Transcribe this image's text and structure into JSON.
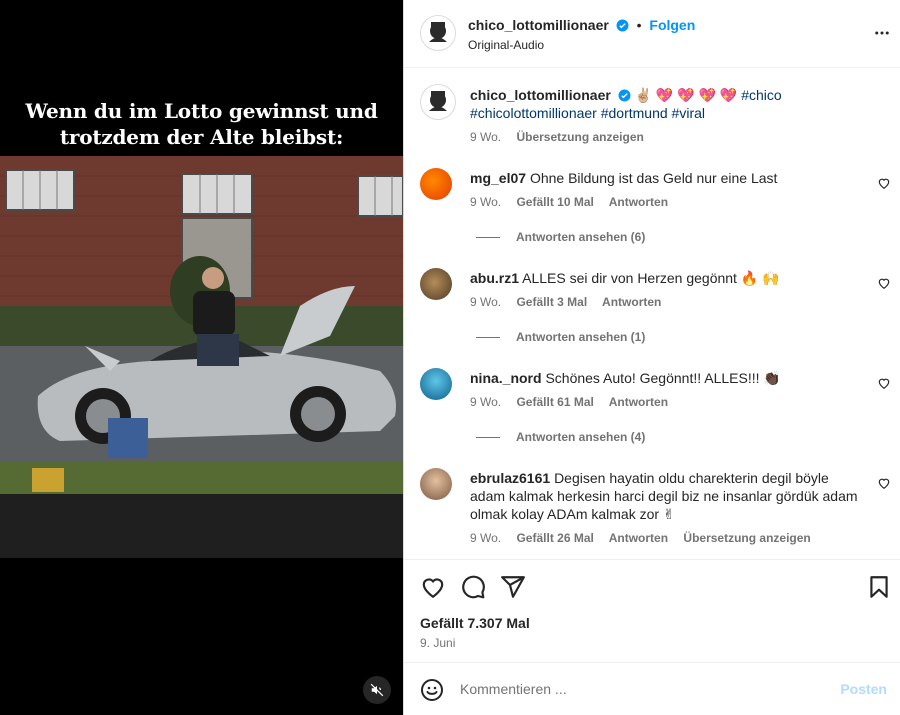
{
  "media": {
    "caption_line1": "Wenn du im Lotto gewinnst und",
    "caption_line2": "trotzdem der Alte bleibst:"
  },
  "header": {
    "username": "chico_lottomillionaer",
    "separator": "•",
    "follow_label": "Folgen",
    "audio": "Original-Audio",
    "more_icon": "more-horizontal-icon"
  },
  "post_caption": {
    "username": "chico_lottomillionaer",
    "emojis": "✌🏼 💖 💖 💖 💖",
    "hashtags_line1": "#chico",
    "hashtags_line2": "#chicolottomillionaer #dortmund #viral",
    "age": "9 Wo.",
    "translate": "Übersetzung anzeigen"
  },
  "comments": [
    {
      "username": "mg_el07",
      "text": "Ohne Bildung ist das Geld nur eine Last",
      "age": "9 Wo.",
      "likes": "Gefällt 10 Mal",
      "reply": "Antworten",
      "view_replies": "Antworten ansehen (6)",
      "avatar_color": "#ff6a00"
    },
    {
      "username": "abu.rz1",
      "text": "ALLES sei dir von Herzen gegönnt 🔥 🙌",
      "age": "9 Wo.",
      "likes": "Gefällt 3 Mal",
      "reply": "Antworten",
      "view_replies": "Antworten ansehen (1)",
      "avatar_color": "#7a5a38"
    },
    {
      "username": "nina._nord",
      "text": "Schönes Auto! Gegönnt!! ALLES!!! 👏🏿",
      "age": "9 Wo.",
      "likes": "Gefällt 61 Mal",
      "reply": "Antworten",
      "view_replies": "Antworten ansehen (4)",
      "avatar_color": "#1f86b8"
    },
    {
      "username": "ebrulaz6161",
      "line1": "Degisen hayatin oldu charekterin degil böyle",
      "line2": "adam kalmak herkesin harci degil biz ne insanlar gördük adam",
      "line3": "olmak kolay ADAm kalmak zor ✌",
      "age": "9 Wo.",
      "likes": "Gefällt 26 Mal",
      "reply": "Antworten",
      "translate": "Übersetzung anzeigen",
      "avatar_color": "#c49a78"
    }
  ],
  "actions": {
    "likes": "Gefällt 7.307 Mal",
    "date": "9. Juni",
    "icons": [
      "heart-icon",
      "comment-icon",
      "share-icon",
      "bookmark-icon"
    ]
  },
  "comment_box": {
    "placeholder": "Kommentieren ...",
    "post_label": "Posten"
  },
  "colors": {
    "accent": "#0095f6",
    "verified": "#0095f6",
    "muted": "#737373",
    "post_disabled": "#b3dbff"
  }
}
